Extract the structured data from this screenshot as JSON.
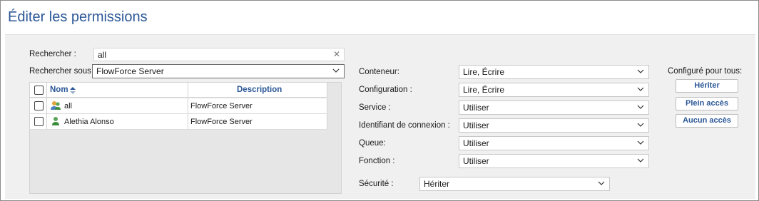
{
  "title": "Éditer les permissions",
  "search": {
    "label": "Rechercher :",
    "value": "all"
  },
  "search_under": {
    "label": "Rechercher sous :",
    "value": "FlowForce Server"
  },
  "table": {
    "columns": [
      "Nom",
      "Description"
    ],
    "rows": [
      {
        "name": "all",
        "description": "FlowForce Server",
        "icon": "user-group-icon"
      },
      {
        "name": "Alethia Alonso",
        "description": "FlowForce Server",
        "icon": "user-icon"
      }
    ]
  },
  "permissions": [
    {
      "label": "Conteneur:",
      "value": "Lire, Écrire"
    },
    {
      "label": "Configuration :",
      "value": "Lire, Écrire"
    },
    {
      "label": "Service :",
      "value": "Utiliser"
    },
    {
      "label": "Identifiant de connexion :",
      "value": "Utiliser"
    },
    {
      "label": "Queue:",
      "value": "Utiliser"
    },
    {
      "label": "Fonction :",
      "value": "Utiliser"
    }
  ],
  "security": {
    "label": "Sécurité :",
    "value": "Hériter"
  },
  "configure_all": {
    "label": "Configuré pour tous:",
    "buttons": [
      "Hériter",
      "Plein accès",
      "Aucun accès"
    ]
  },
  "colors": {
    "accent": "#2b5797",
    "panel": "#f0f0f0"
  }
}
